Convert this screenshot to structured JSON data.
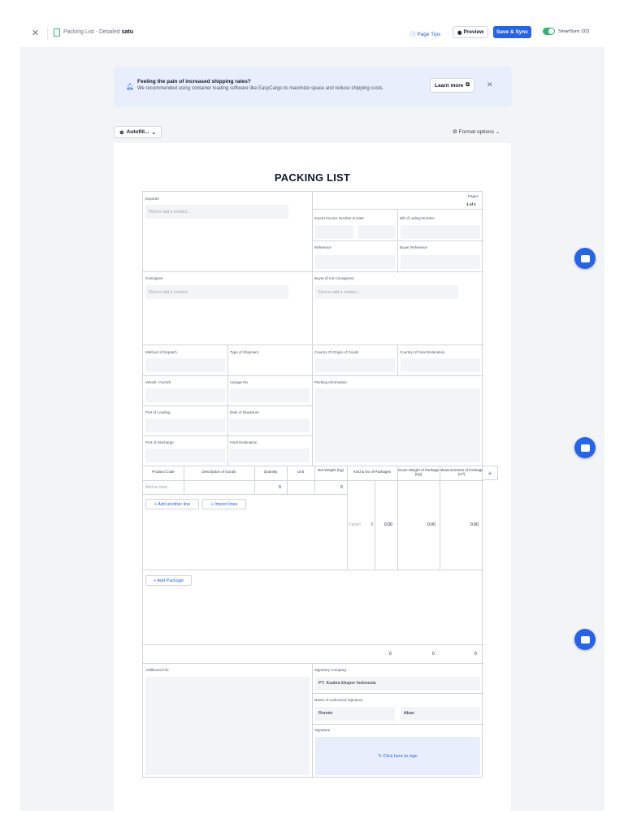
{
  "topbar": {
    "close_icon": "close-icon",
    "doc_icon": "document-icon",
    "doc_title_prefix": "Packing List - Detailed",
    "doc_title_name": "satu",
    "page_tips": "Page Tips",
    "preview": "Preview",
    "save_sync": "Save & Sync",
    "smartsync": "SmartSync (32)",
    "smartsync_on": true
  },
  "banner": {
    "title": "Feeling the pain of increased shipping rates?",
    "text": "We recommended using container loading software like EasyCargo to maximize space and reduce shipping costs.",
    "learn_more": "Learn more"
  },
  "toolbar": {
    "autofill": "Autofill...",
    "format_options": "Format options"
  },
  "document": {
    "heading": "PACKING LIST",
    "pages_label": "Pages",
    "pages_value": "1 of 1",
    "exporter_label": "Exporter",
    "contact_placeholder": "Find or add a contact...",
    "invoice_label": "Export Invoice Number & Date",
    "bol_label": "Bill of Lading Number",
    "reference_label": "Reference",
    "buyer_reference_label": "Buyer Reference",
    "consignee_label": "Consignee",
    "buyer_label": "Buyer (if not Consignee)",
    "method_label": "Method of Dispatch",
    "shipment_type_label": "Type of Shipment",
    "origin_label": "Country Of Origin of Goods",
    "destination_label": "Country of Final Destination",
    "vessel_label": "Vessel / Aircraft",
    "voyage_label": "Voyage No",
    "packing_info_label": "Packing Information",
    "loading_label": "Port of Loading",
    "departure_label": "Date of Departure",
    "discharge_label": "Port of Discharge",
    "final_dest_label": "Final Destination",
    "columns": {
      "product_code": "Product Code",
      "description": "Description of Goods",
      "quantity": "Quantity",
      "unit": "Unit",
      "net_weight": "Net Weight (Kg)",
      "kind_no": "Kind & No of Packages",
      "gross_weight": "Gross Weight of Package (Kg)",
      "measurements": "Measurements of Package (m³)"
    },
    "item_placeholder": "Add an item...",
    "item_quantity": "0",
    "item_net_weight": "0",
    "add_line": "+ Add another line",
    "import_lines": "+ Import lines",
    "package_kind": "Carton",
    "package_x": "X",
    "package_no": "0.00",
    "package_gross": "0.00",
    "package_measure": "0.00",
    "add_package": "+ Add Package",
    "total_net": "0",
    "total_gross": "0",
    "total_measure": "0",
    "additional_info_label": "Additional Info",
    "signatory_company_label": "Signatory Company",
    "signatory_company": "PT. Ksatria Ekspor Indonesia",
    "authorized_label": "Name of Authorized Signatory",
    "signatory_first": "Ronnie",
    "signatory_last": "Aban",
    "signature_label": "Signature",
    "click_to_sign": "Click here to sign",
    "add_column_icon": "plus-icon"
  },
  "colors": {
    "primary": "#2563eb",
    "toggle": "#2bb673",
    "banner_bg": "#e8eefb"
  }
}
